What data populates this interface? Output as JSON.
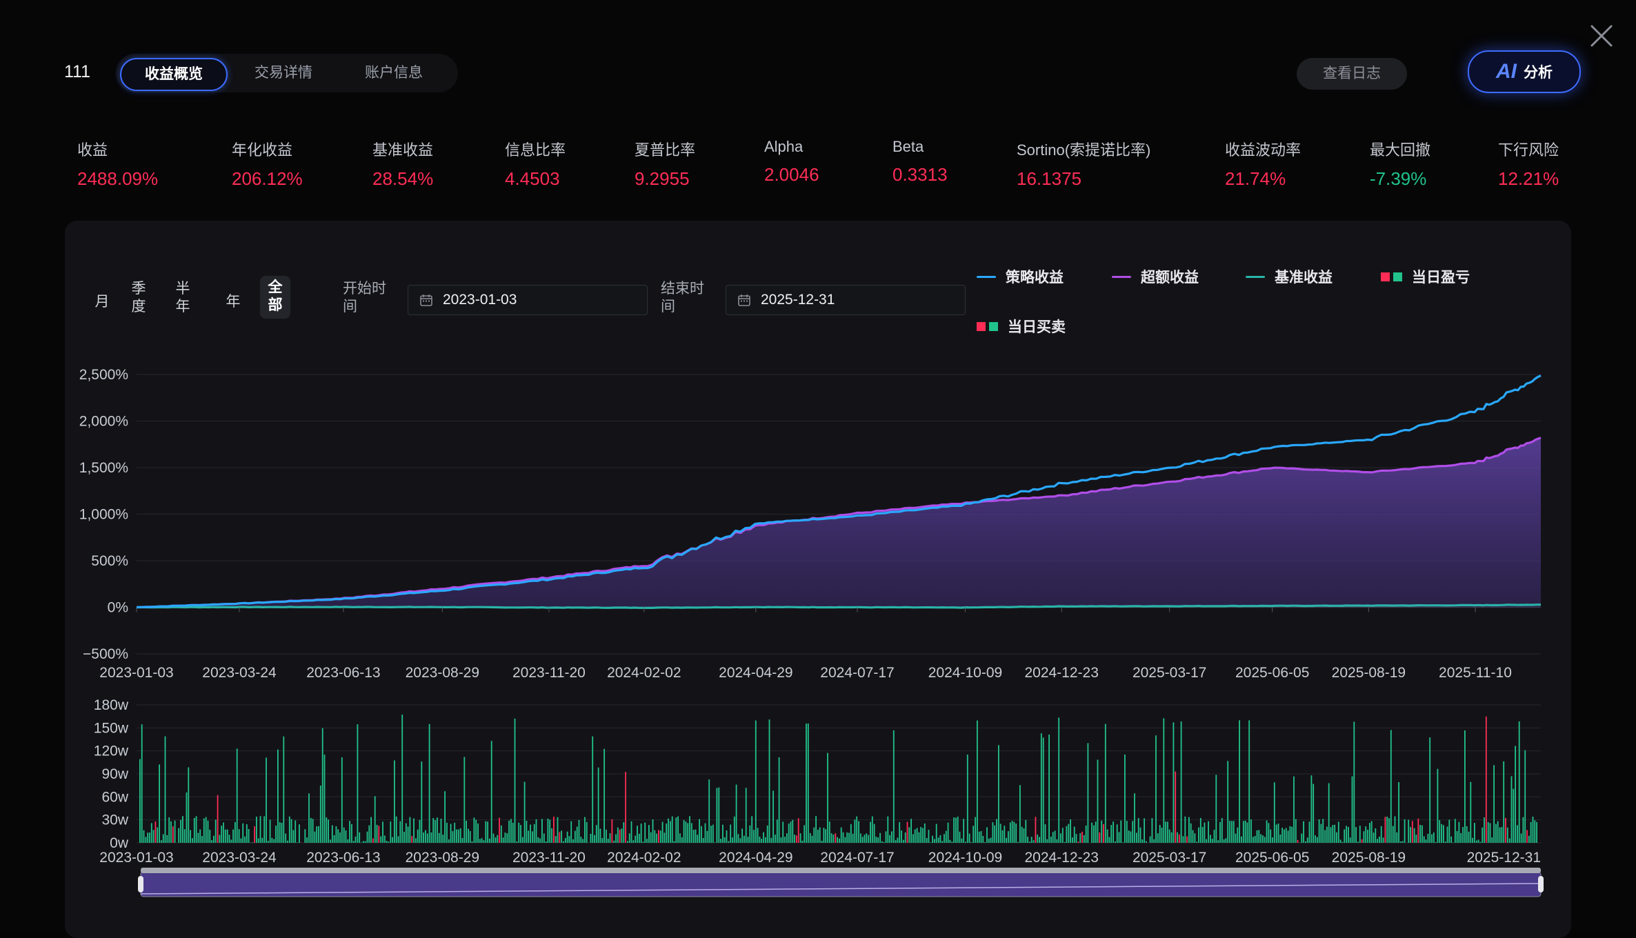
{
  "header": {
    "account_id": "111",
    "tabs": [
      {
        "label": "收益概览",
        "active": true
      },
      {
        "label": "交易详情",
        "active": false
      },
      {
        "label": "账户信息",
        "active": false
      }
    ],
    "log_button": "查看日志",
    "ai_button": {
      "mark": "AI",
      "label": "分析"
    },
    "close_icon": "close-icon"
  },
  "metrics": [
    {
      "label": "收益",
      "value": "2488.09%",
      "color": "#ff2d55"
    },
    {
      "label": "年化收益",
      "value": "206.12%",
      "color": "#ff2d55"
    },
    {
      "label": "基准收益",
      "value": "28.54%",
      "color": "#ff2d55"
    },
    {
      "label": "信息比率",
      "value": "4.4503",
      "color": "#ff2d55"
    },
    {
      "label": "夏普比率",
      "value": "9.2955",
      "color": "#ff2d55"
    },
    {
      "label": "Alpha",
      "value": "2.0046",
      "color": "#ff2d55"
    },
    {
      "label": "Beta",
      "value": "0.3313",
      "color": "#ff2d55"
    },
    {
      "label": "Sortino(索提诺比率)",
      "value": "16.1375",
      "color": "#ff2d55"
    },
    {
      "label": "收益波动率",
      "value": "21.74%",
      "color": "#ff2d55"
    },
    {
      "label": "最大回撤",
      "value": "-7.39%",
      "color": "#21c38b"
    },
    {
      "label": "下行风险",
      "value": "12.21%",
      "color": "#ff2d55"
    }
  ],
  "controls": {
    "periods": [
      {
        "label": "月",
        "active": false
      },
      {
        "label": "季度",
        "active": false
      },
      {
        "label": "半年",
        "active": false
      },
      {
        "label": "年",
        "active": false
      },
      {
        "label": "全部",
        "active": true
      }
    ],
    "start_label": "开始时间",
    "start_value": "2023-01-03",
    "end_label": "结束时间",
    "end_value": "2025-12-31",
    "calendar_icon": "calendar-icon"
  },
  "legend": [
    {
      "label": "策略收益",
      "kind": "line",
      "color": "#2aa8ff"
    },
    {
      "label": "超额收益",
      "kind": "line",
      "color": "#b04ee8"
    },
    {
      "label": "基准收益",
      "kind": "line",
      "color": "#2ab3a8"
    },
    {
      "label": "当日盈亏",
      "kind": "squares",
      "colors": [
        "#ff2d55",
        "#21c38b"
      ]
    },
    {
      "label": "当日买卖",
      "kind": "squares",
      "colors": [
        "#ff2d55",
        "#21c38b"
      ]
    }
  ],
  "chart_data": [
    {
      "type": "line",
      "y_tick_labels": [
        "2,500%",
        "2,000%",
        "1,500%",
        "1,000%",
        "500%",
        "0%",
        "−500%"
      ],
      "ylim": [
        -500,
        2500
      ],
      "x_tick_labels": [
        "2023-01-03",
        "2023-03-24",
        "2023-06-13",
        "2023-08-29",
        "2023-11-20",
        "2024-02-02",
        "2024-04-29",
        "2024-07-17",
        "2024-10-09",
        "2024-12-23",
        "2025-03-17",
        "2025-06-05",
        "2025-08-19",
        "2025-11-10"
      ],
      "x": [
        "2023-01-03",
        "2023-03-24",
        "2023-06-13",
        "2023-08-29",
        "2023-11-20",
        "2024-02-02",
        "2024-04-29",
        "2024-07-17",
        "2024-10-09",
        "2024-12-23",
        "2025-03-17",
        "2025-06-05",
        "2025-08-19",
        "2025-11-10",
        "2025-12-31"
      ],
      "series": [
        {
          "name": "策略收益",
          "values": [
            0,
            40,
            90,
            180,
            300,
            430,
            900,
            980,
            1100,
            1330,
            1500,
            1720,
            1800,
            2100,
            2488
          ]
        },
        {
          "name": "超额收益",
          "values": [
            0,
            40,
            95,
            200,
            320,
            450,
            880,
            1010,
            1120,
            1200,
            1350,
            1500,
            1450,
            1550,
            1820
          ]
        },
        {
          "name": "基准收益",
          "values": [
            0,
            2,
            3,
            2,
            -3,
            -5,
            2,
            0,
            -3,
            10,
            12,
            15,
            18,
            22,
            28
          ]
        }
      ],
      "grid": true
    },
    {
      "type": "bar",
      "y_tick_labels": [
        "180w",
        "150w",
        "120w",
        "90w",
        "60w",
        "30w",
        "0w"
      ],
      "ylim": [
        0,
        180
      ],
      "unit": "w",
      "x_tick_labels": [
        "2023-01-03",
        "2023-03-24",
        "2023-06-13",
        "2023-08-29",
        "2023-11-20",
        "2024-02-02",
        "2024-04-29",
        "2024-07-17",
        "2024-10-09",
        "2024-12-23",
        "2025-03-17",
        "2025-06-05",
        "2025-08-19",
        "2025-12-31"
      ],
      "series": [
        {
          "name": "当日买卖"
        }
      ],
      "grid": true
    }
  ]
}
